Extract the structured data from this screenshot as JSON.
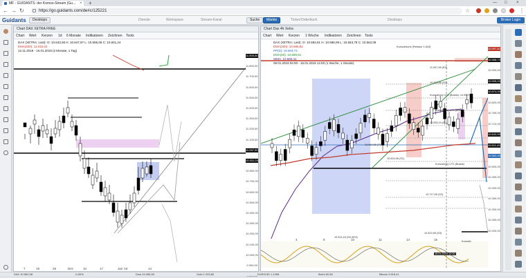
{
  "browser": {
    "tab_title": "MF - GUIDANTS: der Komos-Stream (Gu...",
    "tab_close": "×",
    "new_tab": "+",
    "minimize": "—",
    "maximize": "□",
    "close": "×",
    "url": "https://go.guidants.com/de#c/125221"
  },
  "app": {
    "logo": "Guidants",
    "desktop_label": "Desktops",
    "search_label": "Suche",
    "markets_label": "Märkte",
    "broker_login": "Broker Login",
    "ghost_labels": [
      "Dienste",
      "Workspace",
      "Stream-Kanal",
      "Ticker/Orderbuch",
      "Desktops"
    ]
  },
  "left_panel": {
    "title": "Chart DAX XETRA FREE",
    "tools": [
      "Chart",
      "Wert",
      "Kerzen",
      "1d",
      "6 Monate",
      "Indikatoren",
      "Zeichnen",
      "Tools"
    ],
    "legend": [
      "DAX (XETRA; Last): O: 10.643,36  H: 10.647,97  L: 10.595,06  C: 10.601,24",
      "EMA(200): 11.015,02",
      "12.11.2018 - 16.01.2019 (2 Monate, 1 Tag)"
    ],
    "price_labels": [
      {
        "text": "11.900,00",
        "style": "box"
      },
      {
        "text": "11.800,00",
        "style": ""
      },
      {
        "text": "11.700,00",
        "style": ""
      },
      {
        "text": "11.600,00",
        "style": ""
      },
      {
        "text": "11.500,00",
        "style": ""
      },
      {
        "text": "11.400,00",
        "style": ""
      },
      {
        "text": "11.300,00",
        "style": ""
      },
      {
        "text": "11.200,00",
        "style": ""
      },
      {
        "text": "11.100,00",
        "style": ""
      },
      {
        "text": "11.057,00",
        "style": "box"
      },
      {
        "text": "10.931,24",
        "style": "box"
      },
      {
        "text": "10.800,00",
        "style": ""
      },
      {
        "text": "10.700,00",
        "style": ""
      },
      {
        "text": "10.600,00",
        "style": ""
      },
      {
        "text": "10.500,00",
        "style": ""
      },
      {
        "text": "10.400,00",
        "style": ""
      },
      {
        "text": "10.300,00",
        "style": ""
      },
      {
        "text": "10.200,00",
        "style": ""
      },
      {
        "text": "10.100,00",
        "style": ""
      },
      {
        "text": "10.000,00",
        "style": ""
      },
      {
        "text": "9.900,00",
        "style": ""
      },
      {
        "text": "9.800,00",
        "style": ""
      }
    ],
    "x_labels": [
      "7",
      "19",
      "29",
      "Dez",
      "10",
      "17",
      "Jan '19",
      "14"
    ]
  },
  "right_panel": {
    "title": "Chart Dax 4h Xetra",
    "tools": [
      "Chart",
      "Wert",
      "Kerzen",
      "1 Woche",
      "Indikatoren",
      "Zeichnen",
      "Tools"
    ],
    "legend": [
      "DAX (XETRA; Last): O: 10.592,61  H: 10.596,09  L: 10.563,78  C: 10.562,08",
      "EMA(200): 10.686,82",
      "PP(D): 10.604,74",
      "EMA(50): 10.689,81",
      "WMA: 10.580,41",
      "09.01.2019 04:00 - 16.01.2019 14:00 (1 Woche, 1 Stunde)"
    ],
    "price_labels": [
      {
        "text": "11.097,10",
        "style": "red"
      },
      {
        "text": "10.968,72",
        "style": "box"
      },
      {
        "text": "10.930,00",
        "style": ""
      },
      {
        "text": "10.905,00",
        "style": "box"
      },
      {
        "text": "10.874,00",
        "style": "box"
      },
      {
        "text": "10.820,00",
        "style": ""
      },
      {
        "text": "10.760,00",
        "style": ""
      },
      {
        "text": "10.710,00",
        "style": ""
      },
      {
        "text": "10.642,00",
        "style": "box"
      },
      {
        "text": "10.611,43",
        "style": "box"
      },
      {
        "text": "10.562,00",
        "style": "blue"
      },
      {
        "text": "10.500,00",
        "style": ""
      },
      {
        "text": "10.450,00",
        "style": ""
      },
      {
        "text": "10.400,00",
        "style": ""
      },
      {
        "text": "10.350,00",
        "style": ""
      },
      {
        "text": "10.300,00",
        "style": ""
      },
      {
        "text": "10.250,00",
        "style": ""
      },
      {
        "text": "10.200,00",
        "style": ""
      }
    ],
    "annotations": [
      {
        "text": "Kurszielzone (Retrace 1.618)",
        "cls": "a1"
      },
      {
        "text": "11.067,98 (R3)",
        "cls": "a2"
      },
      {
        "text": "10.926,86 (R2)",
        "cls": "a3"
      },
      {
        "text": "Kursziel(m) LFO (Brasis): 10.95,97",
        "cls": "a4"
      },
      {
        "text": "Kursziel(m) LFO (Brasis)",
        "cls": "a5"
      },
      {
        "text": "10.835,24 (R1)",
        "cls": "a6"
      },
      {
        "text": "10.664,65 (P)",
        "cls": "a7"
      },
      {
        "text": "10.624,96 (S1)",
        "cls": "a8"
      },
      {
        "text": "Kursziel(m) LFO (Brasis)",
        "cls": "a9"
      },
      {
        "text": "10.717,55 (S2)",
        "cls": "a10"
      },
      {
        "text": "10.522,65 (S3)",
        "cls": "a11"
      },
      {
        "text": "10.514,16 (S0,30%)",
        "cls": "a12"
      },
      {
        "text": "Kursziel",
        "cls": "a13"
      },
      {
        "text": "16.01.2019 12:00",
        "cls": "a14"
      }
    ],
    "x_labels": [
      "4",
      "8",
      "10",
      "11",
      "14",
      "15"
    ]
  },
  "status_bar": {
    "items": [
      "DAX 10.562,08",
      "-0,30%",
      "Dow 24.065,59",
      "Gold 1.293,80",
      "EUR/USD 1,1398",
      "Brent 60,56",
      "Bitcoin 3.618,41"
    ]
  },
  "colors": {
    "accent": "#2c6cb5",
    "logo": "#1d4f8c",
    "candle_up": "#ffffff",
    "candle_down": "#111111",
    "resistance_red": "#c0392b"
  }
}
